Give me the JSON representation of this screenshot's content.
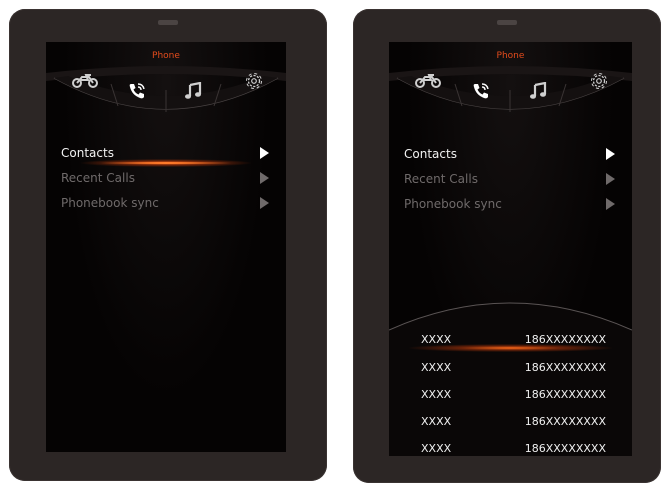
{
  "colors": {
    "accent": "#e24b1c",
    "screen_bg": "#050303",
    "frame": "#2c2625"
  },
  "left_screen": {
    "title": "Phone",
    "tabs": [
      {
        "icon": "motorcycle-icon"
      },
      {
        "icon": "phone-icon",
        "active": true
      },
      {
        "icon": "music-icon"
      },
      {
        "icon": "gear-icon"
      }
    ],
    "menu": [
      {
        "label": "Contacts",
        "active": true
      },
      {
        "label": "Recent Calls",
        "active": false
      },
      {
        "label": "Phonebook sync",
        "active": false
      }
    ]
  },
  "right_screen": {
    "title": "Phone",
    "tabs": [
      {
        "icon": "motorcycle-icon"
      },
      {
        "icon": "phone-icon",
        "active": true
      },
      {
        "icon": "music-icon"
      },
      {
        "icon": "gear-icon"
      }
    ],
    "menu": [
      {
        "label": "Contacts",
        "active": true
      },
      {
        "label": "Recent Calls",
        "active": false
      },
      {
        "label": "Phonebook sync",
        "active": false
      }
    ],
    "contacts": [
      {
        "name": "XXXX",
        "number": "186XXXXXXXX",
        "selected": true
      },
      {
        "name": "XXXX",
        "number": "186XXXXXXXX",
        "selected": false
      },
      {
        "name": "XXXX",
        "number": "186XXXXXXXX",
        "selected": false
      },
      {
        "name": "XXXX",
        "number": "186XXXXXXXX",
        "selected": false
      },
      {
        "name": "XXXX",
        "number": "186XXXXXXXX",
        "selected": false
      }
    ]
  }
}
